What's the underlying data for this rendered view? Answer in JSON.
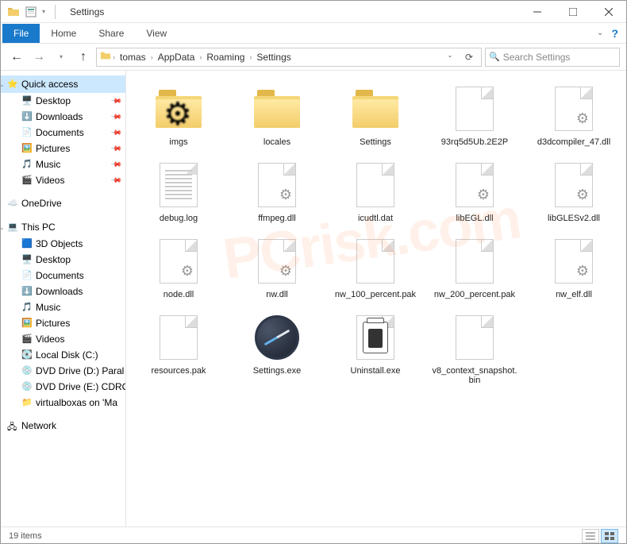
{
  "window": {
    "title": "Settings"
  },
  "ribbon": {
    "file": "File",
    "tabs": [
      "Home",
      "Share",
      "View"
    ]
  },
  "breadcrumbs": [
    "tomas",
    "AppData",
    "Roaming",
    "Settings"
  ],
  "search": {
    "placeholder": "Search Settings"
  },
  "sidebar": {
    "quick_access": "Quick access",
    "quick_items": [
      "Desktop",
      "Downloads",
      "Documents",
      "Pictures",
      "Music",
      "Videos"
    ],
    "onedrive": "OneDrive",
    "this_pc": "This PC",
    "pc_items": [
      "3D Objects",
      "Desktop",
      "Documents",
      "Downloads",
      "Music",
      "Pictures",
      "Videos",
      "Local Disk (C:)",
      "DVD Drive (D:) Paral",
      "DVD Drive (E:) CDRO",
      "virtualboxas on 'Ma"
    ],
    "network": "Network"
  },
  "files": [
    {
      "name": "imgs",
      "type": "folder-cog"
    },
    {
      "name": "locales",
      "type": "folder"
    },
    {
      "name": "Settings",
      "type": "folder"
    },
    {
      "name": "93rq5d5Ub.2E2P",
      "type": "file"
    },
    {
      "name": "d3dcompiler_47.dll",
      "type": "dll"
    },
    {
      "name": "debug.log",
      "type": "text"
    },
    {
      "name": "ffmpeg.dll",
      "type": "dll"
    },
    {
      "name": "icudtl.dat",
      "type": "file"
    },
    {
      "name": "libEGL.dll",
      "type": "dll"
    },
    {
      "name": "libGLESv2.dll",
      "type": "dll"
    },
    {
      "name": "node.dll",
      "type": "dll"
    },
    {
      "name": "nw.dll",
      "type": "dll"
    },
    {
      "name": "nw_100_percent.pak",
      "type": "file"
    },
    {
      "name": "nw_200_percent.pak",
      "type": "file"
    },
    {
      "name": "nw_elf.dll",
      "type": "dll"
    },
    {
      "name": "resources.pak",
      "type": "file"
    },
    {
      "name": "Settings.exe",
      "type": "settings-exe"
    },
    {
      "name": "Uninstall.exe",
      "type": "uninstall"
    },
    {
      "name": "v8_context_snapshot.bin",
      "type": "file"
    }
  ],
  "status": {
    "count": "19 items"
  }
}
